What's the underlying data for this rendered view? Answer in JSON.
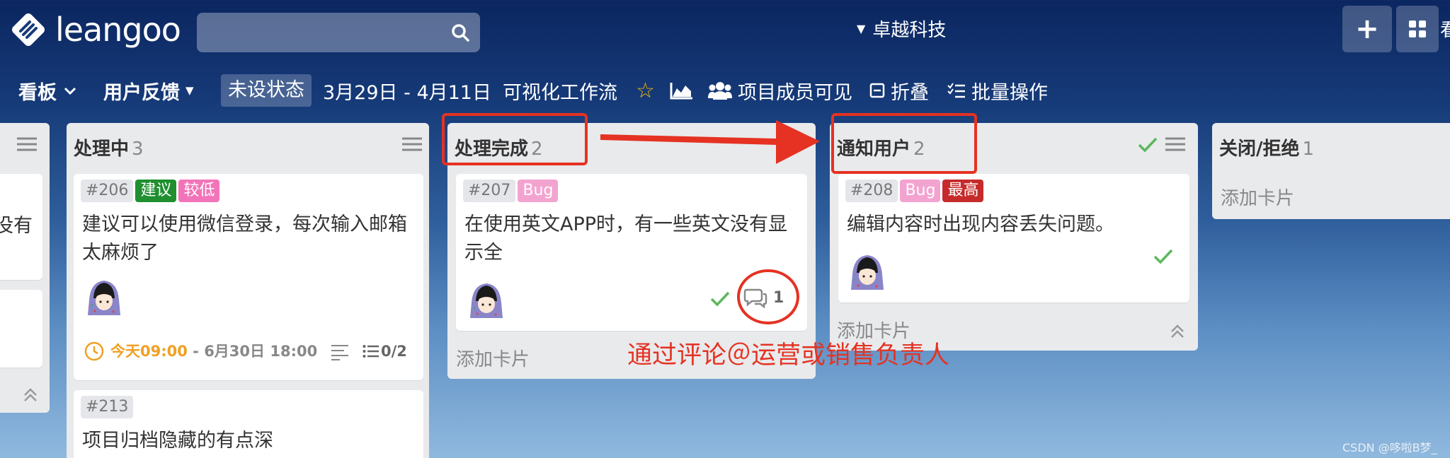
{
  "app": {
    "logo_text": "leangoo",
    "team_name": "卓越科技",
    "top_more_text": "看"
  },
  "search": {
    "placeholder": ""
  },
  "board_bar": {
    "view_label": "看板",
    "board_name": "用户反馈",
    "status_label": "未设状态",
    "date_range": "3月29日 - 4月11日",
    "flow_label": "可视化工作流",
    "members_label": "项目成员可见",
    "fold_label": "折叠",
    "batch_label": "批量操作"
  },
  "columns": [
    {
      "title": "",
      "count": "",
      "cards": [
        {
          "title": "没有"
        }
      ]
    },
    {
      "title": "处理中",
      "count": "3",
      "cards": [
        {
          "number": "#206",
          "tags": [
            "建议",
            "较低"
          ],
          "title": "建议可以使用微信登录，每次输入邮箱太麻烦了",
          "due_start": "今天09:00",
          "due_end": " - 6月30日 18:00",
          "checklist": "0/2"
        },
        {
          "number": "#213",
          "title": "项目归档隐藏的有点深"
        }
      ]
    },
    {
      "title": "处理完成",
      "count": "2",
      "cards": [
        {
          "number": "#207",
          "tags": [
            "Bug"
          ],
          "title": "在使用英文APP时，有一些英文没有显示全",
          "comments": "1"
        }
      ],
      "add_card": "添加卡片"
    },
    {
      "title": "通知用户",
      "count": "2",
      "cards": [
        {
          "number": "#208",
          "tags": [
            "Bug",
            "最高"
          ],
          "title": "编辑内容时出现内容丢失问题。"
        }
      ],
      "add_card": "添加卡片"
    },
    {
      "title": "关闭/拒绝",
      "count": "1",
      "cards": [],
      "add_card": "添加卡片"
    }
  ],
  "annotation": {
    "text": "通过评论＠运营或销售负责人"
  },
  "watermark": "CSDN @哆啦B梦_",
  "colors": {
    "accent_red": "#e53222",
    "tag_green": "#1f8f2f",
    "tag_pink": "#f274b8",
    "tag_high": "#c62a2a",
    "due_orange": "#f0a023",
    "check_green": "#5cb85c"
  },
  "icons": [
    "search-icon",
    "star-icon",
    "chart-icon",
    "members-icon",
    "fold-icon",
    "batch-icon",
    "menu-icon",
    "check-icon",
    "comment-icon",
    "clock-icon",
    "description-icon",
    "checklist-icon",
    "collapse-icon",
    "plus-icon",
    "grid-icon"
  ]
}
